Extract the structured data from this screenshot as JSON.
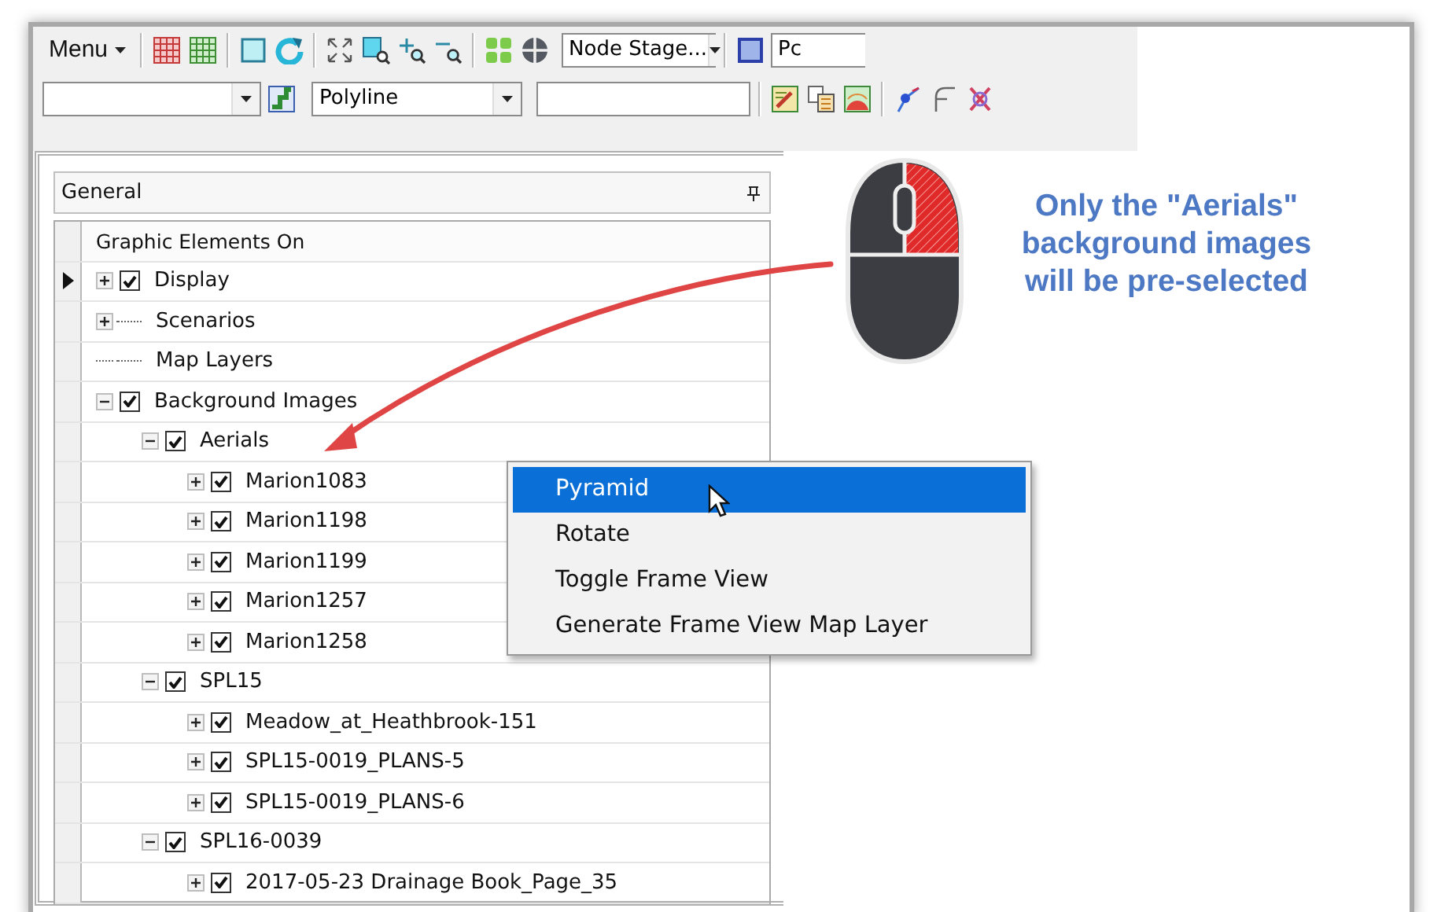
{
  "toolbar": {
    "menu_label": "Menu",
    "stage_dropdown": "Node Stage...",
    "cut_dropdown": "Pc",
    "type_dropdown": "Polyline"
  },
  "panel": {
    "title": "General",
    "column_header": "Graphic Elements On",
    "tree": [
      {
        "label": "Display",
        "kind": "check",
        "checked": true,
        "expandable": true,
        "current": true
      },
      {
        "label": "Scenarios",
        "kind": "plain",
        "expandable": true,
        "current": false
      },
      {
        "label": "Map Layers",
        "kind": "plain",
        "expandable": false,
        "current": false
      },
      {
        "label": "Background Images",
        "kind": "check",
        "checked": true,
        "expandable": true,
        "current": false,
        "children": [
          {
            "label": "Aerials",
            "kind": "check",
            "checked": true,
            "expandable": true,
            "current": false,
            "children": [
              {
                "label": "Marion1083",
                "kind": "check",
                "checked": true,
                "expandable": true,
                "current": false
              },
              {
                "label": "Marion1198",
                "kind": "check",
                "checked": true,
                "expandable": true,
                "current": false
              },
              {
                "label": "Marion1199",
                "kind": "check",
                "checked": true,
                "expandable": true,
                "current": false
              },
              {
                "label": "Marion1257",
                "kind": "check",
                "checked": true,
                "expandable": true,
                "current": false
              },
              {
                "label": "Marion1258",
                "kind": "check",
                "checked": true,
                "expandable": true,
                "current": false
              }
            ]
          },
          {
            "label": "SPL15",
            "kind": "check",
            "checked": true,
            "expandable": true,
            "current": false,
            "children": [
              {
                "label": "Meadow_at_Heathbrook-151",
                "kind": "check",
                "checked": true,
                "expandable": true,
                "current": false
              },
              {
                "label": "SPL15-0019_PLANS-5",
                "kind": "check",
                "checked": true,
                "expandable": true,
                "current": false
              },
              {
                "label": "SPL15-0019_PLANS-6",
                "kind": "check",
                "checked": true,
                "expandable": true,
                "current": false
              }
            ]
          },
          {
            "label": "SPL16-0039",
            "kind": "check",
            "checked": true,
            "expandable": true,
            "current": false,
            "children": [
              {
                "label": "2017-05-23 Drainage Book_Page_35",
                "kind": "check",
                "checked": true,
                "expandable": true,
                "current": false
              }
            ]
          }
        ]
      }
    ]
  },
  "context_menu": [
    {
      "label": "Pyramid",
      "selected": true
    },
    {
      "label": "Rotate",
      "selected": false
    },
    {
      "label": "Toggle Frame View",
      "selected": false
    },
    {
      "label": "Generate Frame View Map Layer",
      "selected": false
    }
  ],
  "callout": {
    "text": "Only the \"Aerials\" background images will be pre-selected"
  }
}
